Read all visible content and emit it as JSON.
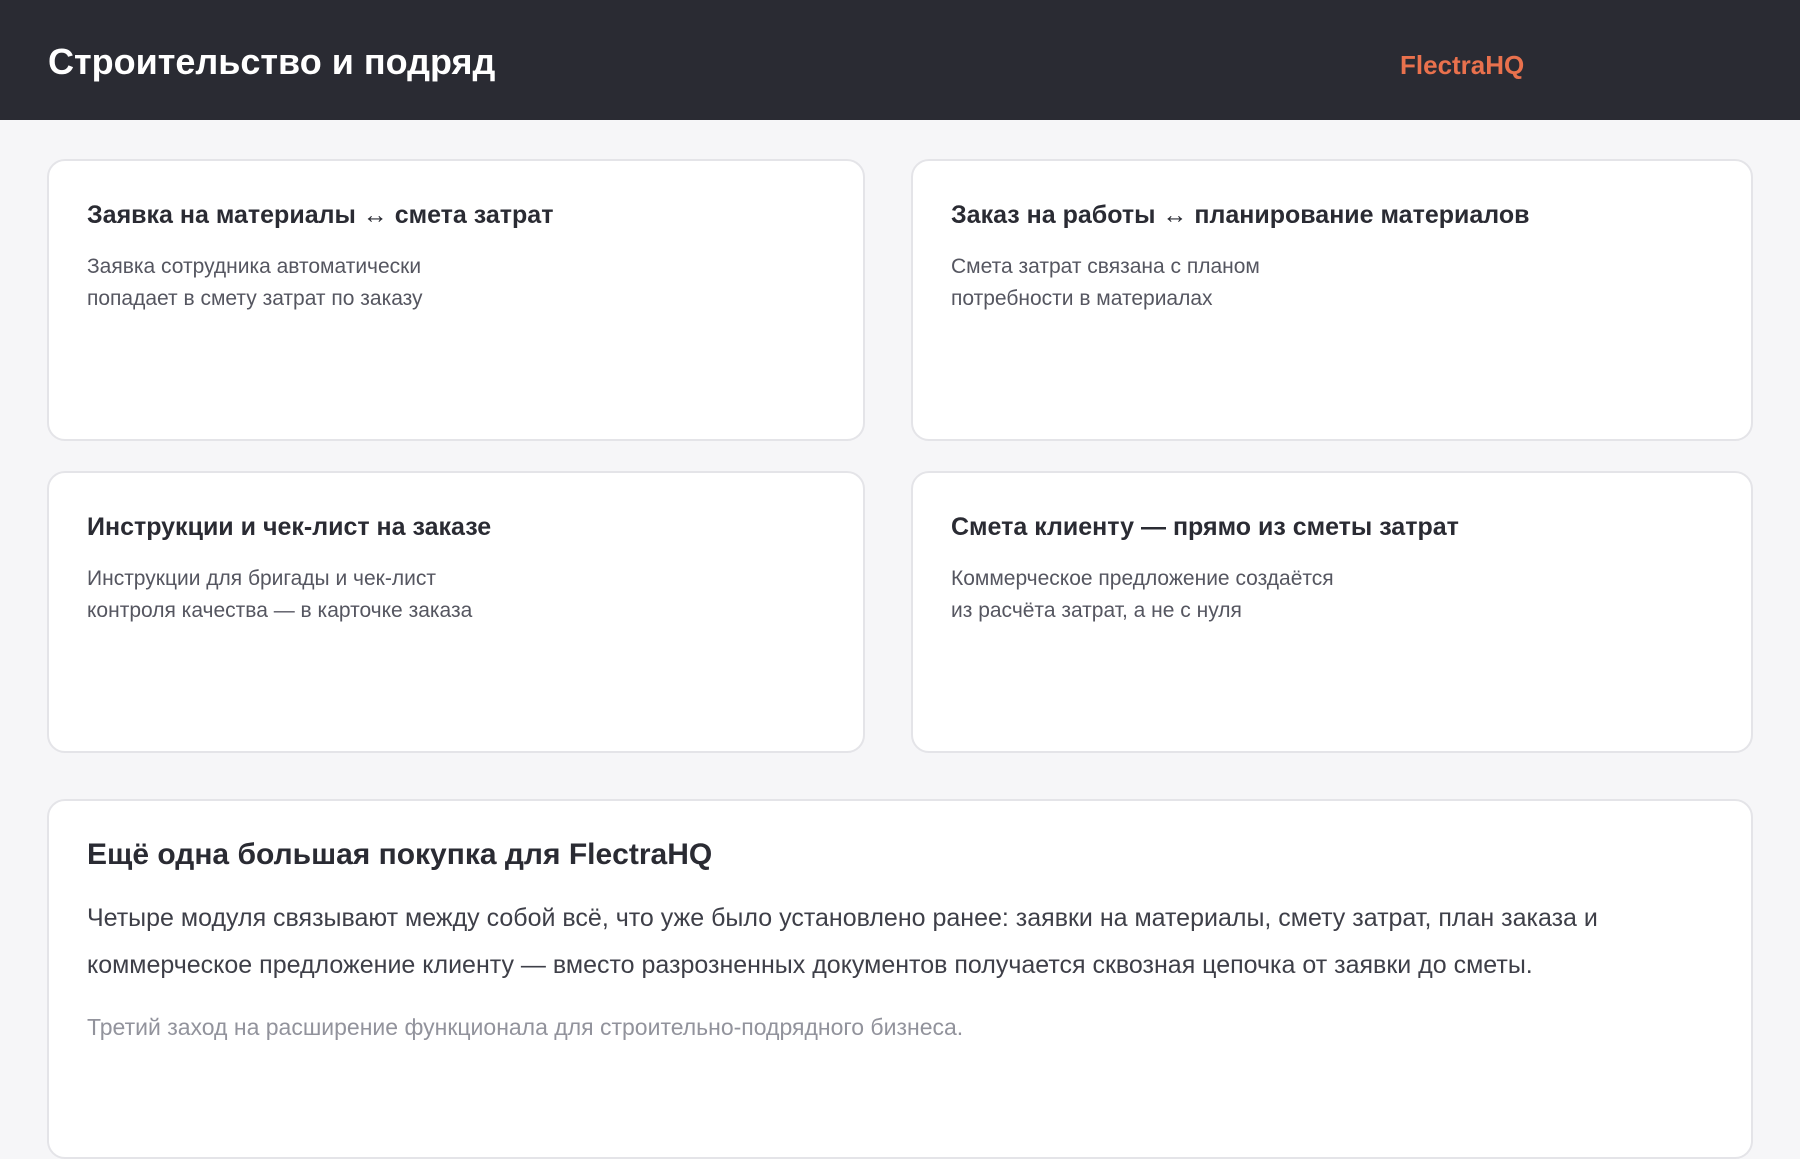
{
  "header": {
    "title": "Строительство и подряд",
    "brand": "FlectraHQ",
    "brand_color": "#e9714d",
    "background_color": "#2a2b33"
  },
  "cards": [
    {
      "title": "Заявка на материалы ↔ смета затрат",
      "description": "Заявка сотрудника автоматически попадает в смету затрат по заказу"
    },
    {
      "title": "Заказ на работы ↔ планирование материалов",
      "description": "Смета затрат связана с планом потребности в материалах"
    },
    {
      "title": "Инструкции и чек-лист на заказе",
      "description": "Инструкции для бригады и чек-лист контроля качества — в карточке заказа"
    },
    {
      "title": "Смета клиенту — прямо из сметы затрат",
      "description": "Коммерческое предложение создаётся из расчёта затрат, а не с нуля"
    }
  ],
  "summary": {
    "title": "Ещё одна большая покупка для FlectraHQ",
    "body": "Четыре модуля связывают между собой всё, что уже было установлено ранее: заявки на материалы, смету затрат, план заказа и коммерческое предложение клиенту — вместо разрозненных документов получается сквозная цепочка от заявки до сметы.",
    "note": "Третий заход на расширение функционала для строительно-подрядного бизнеса."
  }
}
